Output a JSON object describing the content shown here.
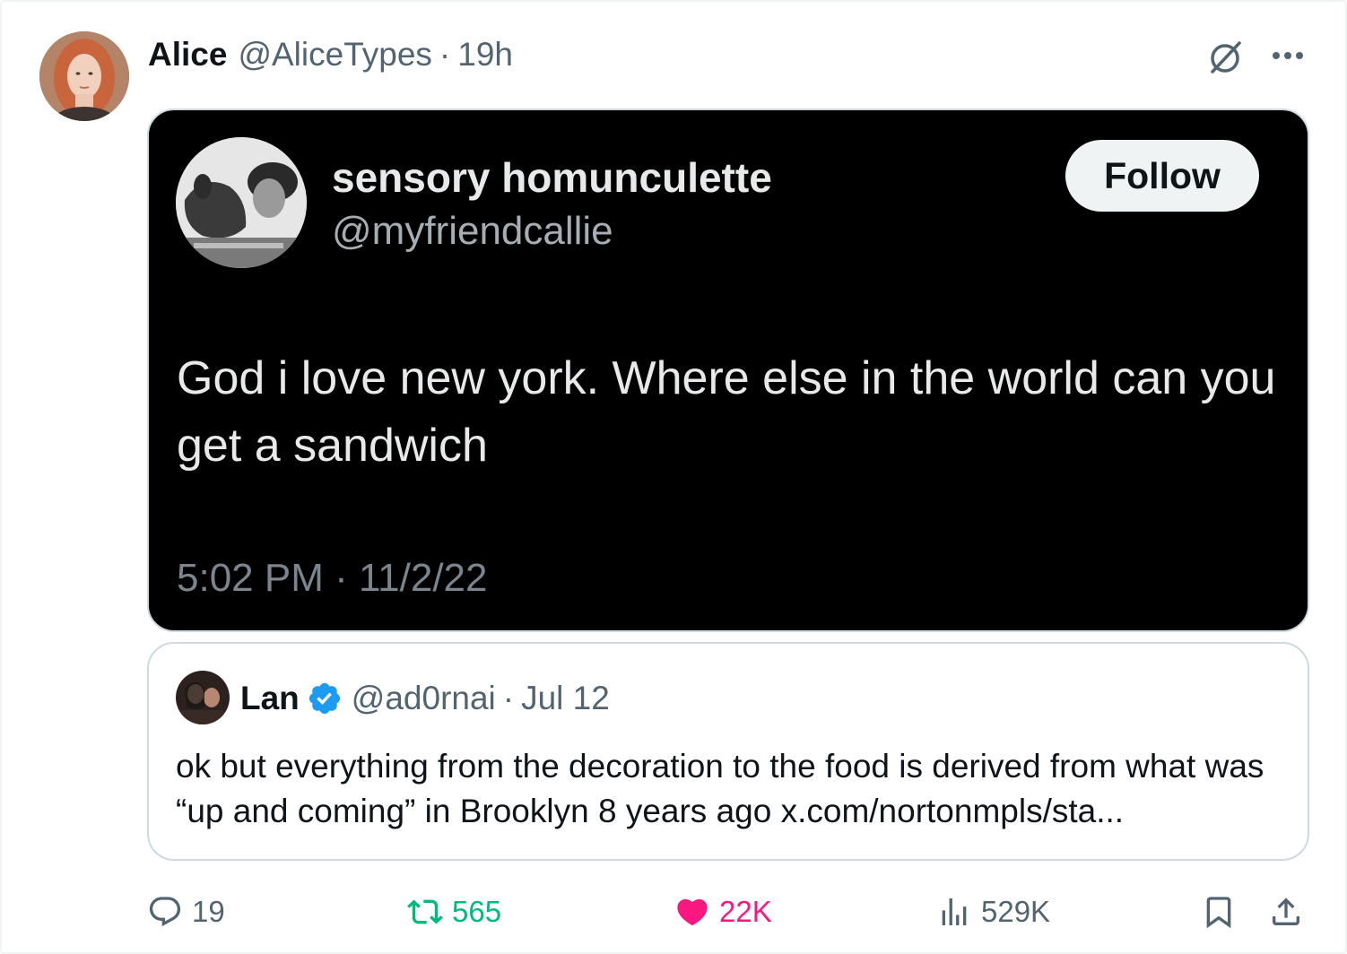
{
  "author": {
    "name": "Alice",
    "handle": "@AliceTypes",
    "separator": "·",
    "time": "19h"
  },
  "icons": {
    "grok": "grok-slash-circle-icon",
    "more": "more-horizontal-icon",
    "verified": "verified-badge-icon",
    "reply": "reply-bubble-icon",
    "retweet": "retweet-icon",
    "like": "heart-filled-icon",
    "views": "views-bar-chart-icon",
    "bookmark": "bookmark-icon",
    "share": "share-upload-icon"
  },
  "embedded_screenshot": {
    "name": "sensory homunculette",
    "handle": "@myfriendcallie",
    "follow_label": "Follow",
    "text": "God i love new york. Where else in the world can you get a sandwich",
    "timestamp": "5:02 PM · 11/2/22"
  },
  "quote": {
    "name": "Lan",
    "handle": "@ad0rnai",
    "separator": "·",
    "date": "Jul 12",
    "text": "ok but everything from the decoration to the food is derived from what was “up and coming” in Brooklyn 8 years ago x.com/nortonmpls/sta..."
  },
  "actions": {
    "replies": "19",
    "retweets": "565",
    "likes": "22K",
    "views": "529K"
  },
  "colors": {
    "text_primary": "#0f1419",
    "text_secondary": "#536471",
    "border": "#cfd9de",
    "retweet_green": "#00ba7c",
    "like_pink": "#f91880",
    "verified_blue": "#1d9bf0",
    "dark_card": "#000000"
  }
}
